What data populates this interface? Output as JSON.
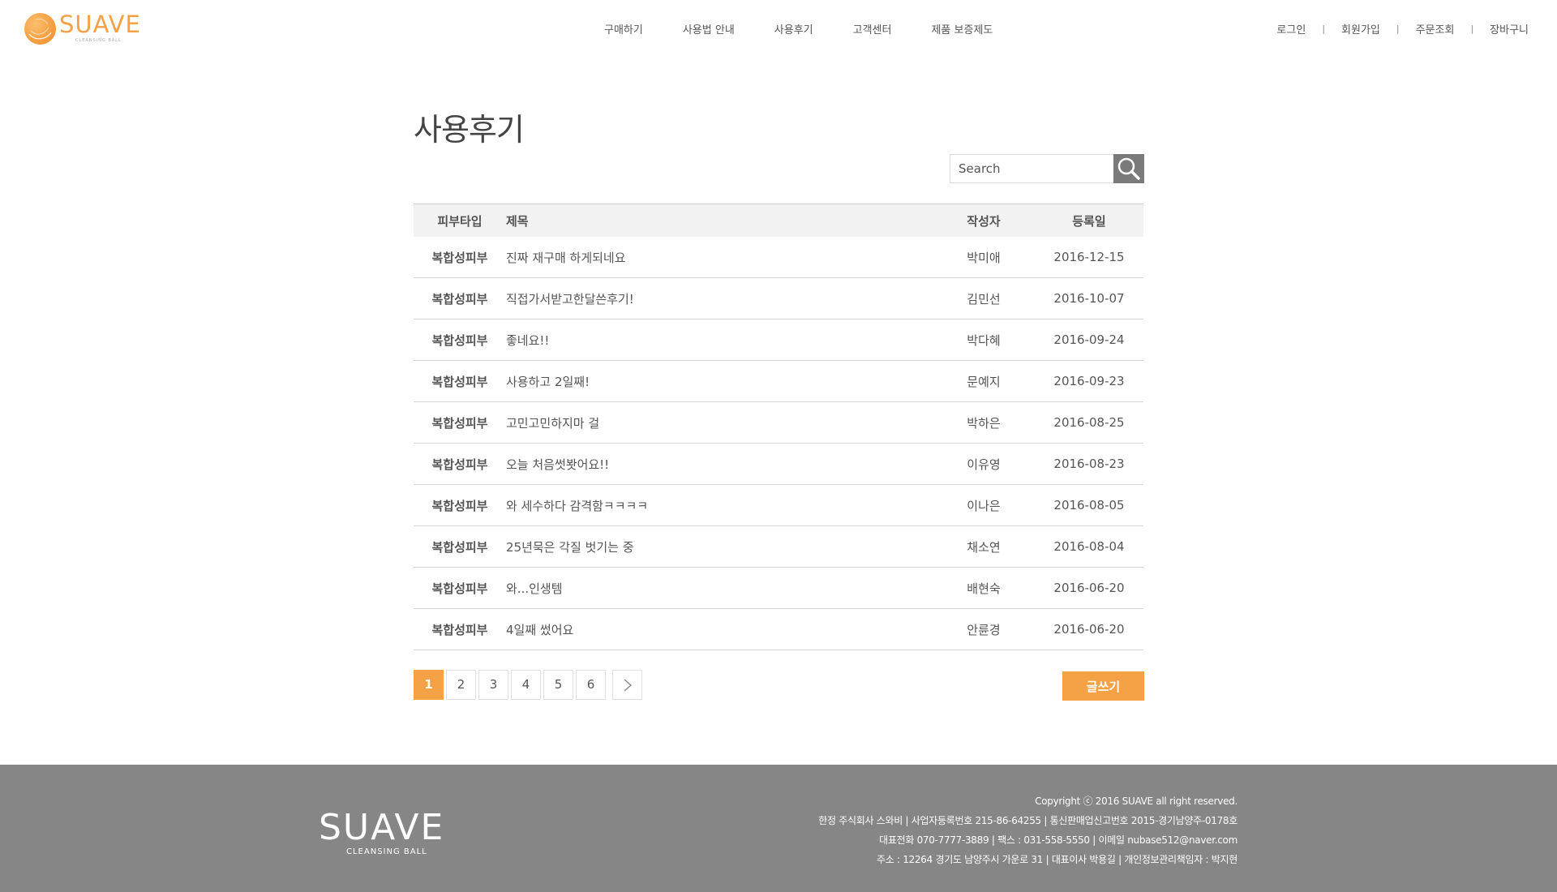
{
  "brand": {
    "name": "SUAVE",
    "tagline": "CLEANSING BALL",
    "accent_color": "#f5a145"
  },
  "nav": {
    "items": [
      "구매하기",
      "사용법 안내",
      "사용후기",
      "고객센터",
      "제품 보증제도"
    ]
  },
  "util": {
    "login": "로그인",
    "join": "회원가입",
    "orders": "주문조회",
    "cart": "장바구니",
    "separator": "|"
  },
  "page": {
    "title": "사용후기"
  },
  "search": {
    "placeholder": "Search",
    "icon": "search-icon"
  },
  "board": {
    "headers": {
      "type": "피부타입",
      "title": "제목",
      "author": "작성자",
      "date": "등록일"
    },
    "rows": [
      {
        "type": "복합성피부",
        "title": "진짜 재구매 하게되네요",
        "author": "박미애",
        "date": "2016-12-15"
      },
      {
        "type": "복합성피부",
        "title": "직접가서받고한달쓴후기!",
        "author": "김민선",
        "date": "2016-10-07"
      },
      {
        "type": "복합성피부",
        "title": "좋네요!!",
        "author": "박다혜",
        "date": "2016-09-24"
      },
      {
        "type": "복합성피부",
        "title": "사용하고 2일째!",
        "author": "문예지",
        "date": "2016-09-23"
      },
      {
        "type": "복합성피부",
        "title": "고민고민하지마 걸",
        "author": "박하은",
        "date": "2016-08-25"
      },
      {
        "type": "복합성피부",
        "title": "오늘 처음썻봣어요!!",
        "author": "이유영",
        "date": "2016-08-23"
      },
      {
        "type": "복합성피부",
        "title": "와 세수하다 감격함ㅋㅋㅋㅋ",
        "author": "이나은",
        "date": "2016-08-05"
      },
      {
        "type": "복합성피부",
        "title": "25년묵은 각질 벗기는 중",
        "author": "채소연",
        "date": "2016-08-04"
      },
      {
        "type": "복합성피부",
        "title": "와...인생템",
        "author": "배현숙",
        "date": "2016-06-20"
      },
      {
        "type": "복합성피부",
        "title": "4일째 썼어요",
        "author": "안륜경",
        "date": "2016-06-20"
      }
    ]
  },
  "pagination": {
    "pages": [
      "1",
      "2",
      "3",
      "4",
      "5",
      "6"
    ],
    "current": "1",
    "next_icon": "chevron-right-icon"
  },
  "write_button": {
    "label": "글쓰기"
  },
  "footer": {
    "logo": "SUAVE",
    "logo_sub": "CLEANSING BALL",
    "lines": [
      "Copyright ⓒ 2016 SUAVE all right reserved.",
      "한정 주식회사 스와비 | 사업자등록번호 215-86-64255 | 통신판매업신고번호 2015-경기남양주-0178호",
      "대표전화 070-7777-3889 | 팩스 : 031-558-5550 | 이메일 nubase512@naver.com",
      "주소 : 12264 경기도 남양주시 가운로 31 | 대표이사 박용길 | 개인정보관리책임자 : 박지현"
    ],
    "background_color": "#868686"
  }
}
